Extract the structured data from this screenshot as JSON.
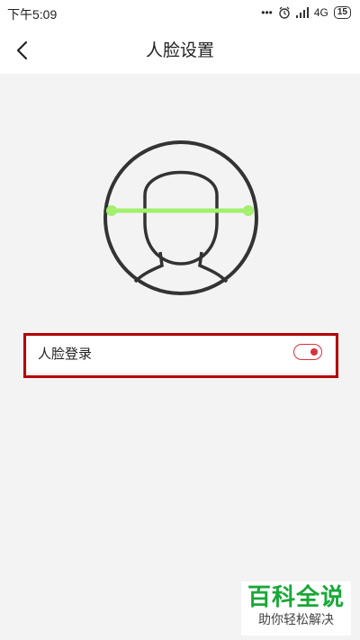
{
  "status_bar": {
    "time": "下午5:09",
    "dots": "•••",
    "network": "4G",
    "battery": "15"
  },
  "header": {
    "title": "人脸设置",
    "back_icon": "chevron-left-icon"
  },
  "illustration": {
    "icon": "face-scan-icon",
    "line_color": "#a3ef6e",
    "stroke_color": "#333333"
  },
  "settings": {
    "face_login": {
      "label": "人脸登录",
      "enabled": true,
      "toggle_color": "#d9323f"
    }
  },
  "highlight": {
    "color": "#b30000"
  },
  "watermark": {
    "title": "百科全说",
    "subtitle": "助你轻松解决",
    "color": "#19a838"
  }
}
